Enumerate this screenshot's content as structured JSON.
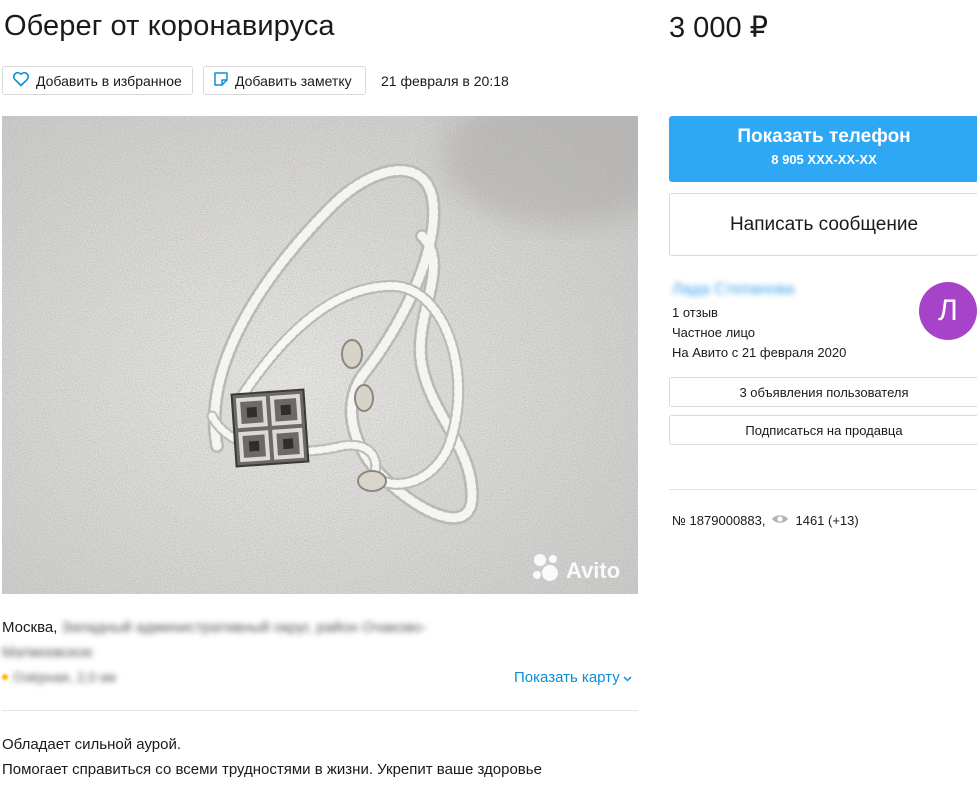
{
  "listing": {
    "title": "Оберег от коронавируса",
    "price": "3 000 ₽",
    "favorite_label": "Добавить в избранное",
    "note_label": "Добавить заметку",
    "date": "21 февраля в 20:18"
  },
  "photo": {
    "watermark": "Avito"
  },
  "location": {
    "city": "Москва,",
    "district": "Западный административный округ, район Очаково-",
    "district2": "Матвеевское",
    "metro": "Озёрная, 2,0 км",
    "show_map": "Показать карту"
  },
  "description": {
    "line1": "Обладает сильной аурой.",
    "line2": "Помогает справиться со всеми трудностями в жизни. Укрепит ваше здоровье"
  },
  "contact": {
    "phone_label": "Показать телефон",
    "phone_number": "8 905 XXX-XX-XX",
    "message_label": "Написать сообщение"
  },
  "seller": {
    "name": "Лада Степанова",
    "reviews": "1 отзыв",
    "type": "Частное лицо",
    "since": "На Авито с 21 февраля 2020",
    "avatar_letter": "Л",
    "listings_button": "3 объявления пользователя",
    "subscribe_button": "Подписаться на продавца"
  },
  "stats": {
    "item_number": "№ 1879000883,",
    "views": "1461 (+13)"
  },
  "colors": {
    "accent_blue": "#2ea8f5",
    "link_blue": "#0a8fdb",
    "avatar_purple": "#a643c9"
  }
}
